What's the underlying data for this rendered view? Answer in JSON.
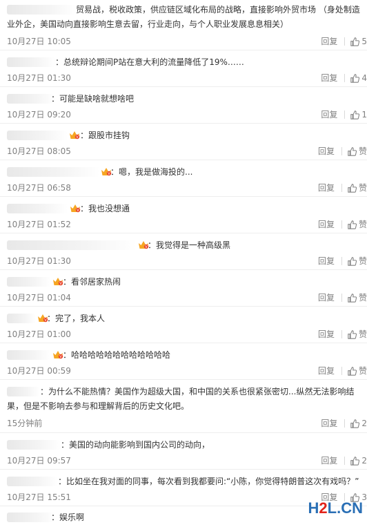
{
  "reply_label": "回复",
  "comments": [
    {
      "text": "贸易战，税收政策，供应链区域化布局的战略，直接影响外贸市场 （身处制造业外企，美国动向直接影响生意去留，行业走向，与个人职业发展息息相关）",
      "time": "10月27日 10:05",
      "like": "5"
    },
    {
      "text": "：总统辩论期间P站在意大利的流量降低了19%……",
      "time": "10月27日 01:30",
      "like": "4"
    },
    {
      "text": "：可能是缺啥就想啥吧",
      "time": "10月27日 09:20",
      "like": "1"
    },
    {
      "text": "：跟股市挂钩",
      "time": "10月27日 08:05",
      "like": "赞"
    },
    {
      "text": "：嗯，我是做海投的...",
      "time": "10月27日 06:58",
      "like": "赞"
    },
    {
      "text": "：我也没想通",
      "time": "10月27日 01:52",
      "like": "赞"
    },
    {
      "text": "：我觉得是一种高级黑",
      "time": "10月27日 01:30",
      "like": "赞"
    },
    {
      "text": "：看邻居家热闹",
      "time": "10月27日 01:04",
      "like": "赞"
    },
    {
      "text": "：完了，我本人",
      "time": "10月27日 01:00",
      "like": "赞"
    },
    {
      "text": "：哈哈哈哈哈哈哈哈哈哈哈哈",
      "time": "10月27日 00:59",
      "like": "赞"
    },
    {
      "text": "：为什么不能热情？美国作为超级大国，和中国的关系也很紧张密切...纵然无法影响结果，但是不影响去参与和理解背后的历史文化吧。",
      "time": "15分钟前",
      "like": "2"
    },
    {
      "text": "：美国的动向能影响到国内公司的动向，",
      "time": "10月27日 09:57",
      "like": "2"
    },
    {
      "text": "：比如坐在我对面的同事，每次看到我都要问:“小陈，你觉得特朗普这次有戏吗？”",
      "time": "10月27日 15:51",
      "like": "3"
    },
    {
      "text": "：娱乐啊",
      "time": "",
      "like": ""
    }
  ],
  "watermark": {
    "part1": "H",
    "part2": "2",
    "part3": "L.CN"
  }
}
